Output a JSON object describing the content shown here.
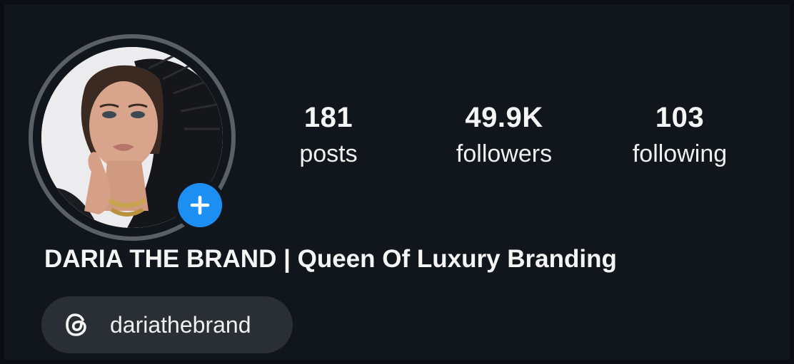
{
  "profile": {
    "display_name": "DARIA THE BRAND | Queen Of Luxury Branding",
    "avatar_icon": "profile-photo",
    "add_story_icon": "plus-icon"
  },
  "stats": {
    "posts": {
      "value": "181",
      "label": "posts"
    },
    "followers": {
      "value": "49.9K",
      "label": "followers"
    },
    "following": {
      "value": "103",
      "label": "following"
    }
  },
  "threads": {
    "icon": "threads-icon",
    "handle": "dariathebrand"
  },
  "colors": {
    "background": "#11151c",
    "accent": "#1d8ff2",
    "chip": "#2a2e35",
    "ring": "#5b6068"
  }
}
